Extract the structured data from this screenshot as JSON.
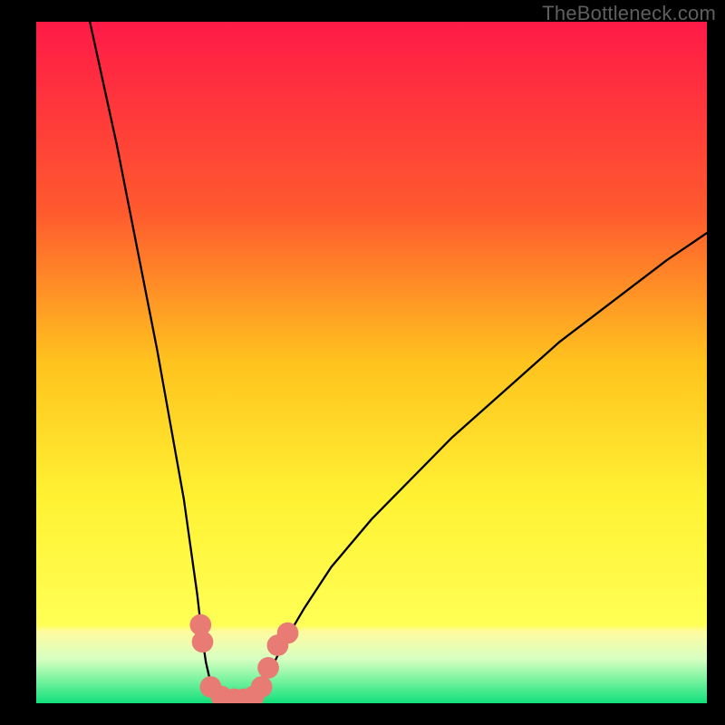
{
  "watermark": "TheBottleneck.com",
  "chart_data": {
    "type": "line",
    "title": "",
    "xlabel": "",
    "ylabel": "",
    "xlim": [
      0,
      100
    ],
    "ylim": [
      0,
      100
    ],
    "grid": false,
    "legend": false,
    "gradient_stops": [
      {
        "offset": 0,
        "color": "#ff1a47"
      },
      {
        "offset": 0.28,
        "color": "#ff5a2e"
      },
      {
        "offset": 0.5,
        "color": "#ffc31e"
      },
      {
        "offset": 0.7,
        "color": "#fff233"
      },
      {
        "offset": 0.885,
        "color": "#ffff55"
      },
      {
        "offset": 0.895,
        "color": "#fffba0"
      },
      {
        "offset": 0.935,
        "color": "#d7ffc2"
      },
      {
        "offset": 0.965,
        "color": "#7cf3a0"
      },
      {
        "offset": 1.0,
        "color": "#11e07c"
      }
    ],
    "series": [
      {
        "name": "left-branch",
        "x": [
          8,
          10,
          12,
          14,
          16,
          18,
          20,
          22,
          23,
          24,
          24.7,
          25.3,
          26,
          27,
          28
        ],
        "y": [
          100,
          91,
          82,
          72,
          62,
          52,
          41,
          30,
          23,
          16,
          10,
          6,
          3,
          1,
          0
        ]
      },
      {
        "name": "right-branch",
        "x": [
          32,
          33,
          34,
          35,
          37,
          40,
          44,
          50,
          56,
          62,
          70,
          78,
          86,
          94,
          100
        ],
        "y": [
          0,
          1,
          3,
          5,
          9,
          14,
          20,
          27,
          33,
          39,
          46,
          53,
          59,
          65,
          69
        ]
      }
    ],
    "floor_segment": {
      "x0": 27,
      "x1": 33,
      "y": 0
    },
    "markers": [
      {
        "x": 24.5,
        "y": 11.5,
        "r": 1.6
      },
      {
        "x": 24.8,
        "y": 9.0,
        "r": 1.6
      },
      {
        "x": 26.0,
        "y": 2.4,
        "r": 1.6
      },
      {
        "x": 27.6,
        "y": 1.0,
        "r": 1.6
      },
      {
        "x": 29.5,
        "y": 0.6,
        "r": 1.6
      },
      {
        "x": 31.0,
        "y": 0.6,
        "r": 1.6
      },
      {
        "x": 32.4,
        "y": 1.0,
        "r": 1.6
      },
      {
        "x": 33.6,
        "y": 2.4,
        "r": 1.6
      },
      {
        "x": 34.6,
        "y": 5.2,
        "r": 1.6
      },
      {
        "x": 36.0,
        "y": 8.5,
        "r": 1.6
      },
      {
        "x": 37.5,
        "y": 10.3,
        "r": 1.6
      }
    ],
    "marker_color": "#e87b74",
    "curve_color": "#000000",
    "curve_width": 2.3
  }
}
